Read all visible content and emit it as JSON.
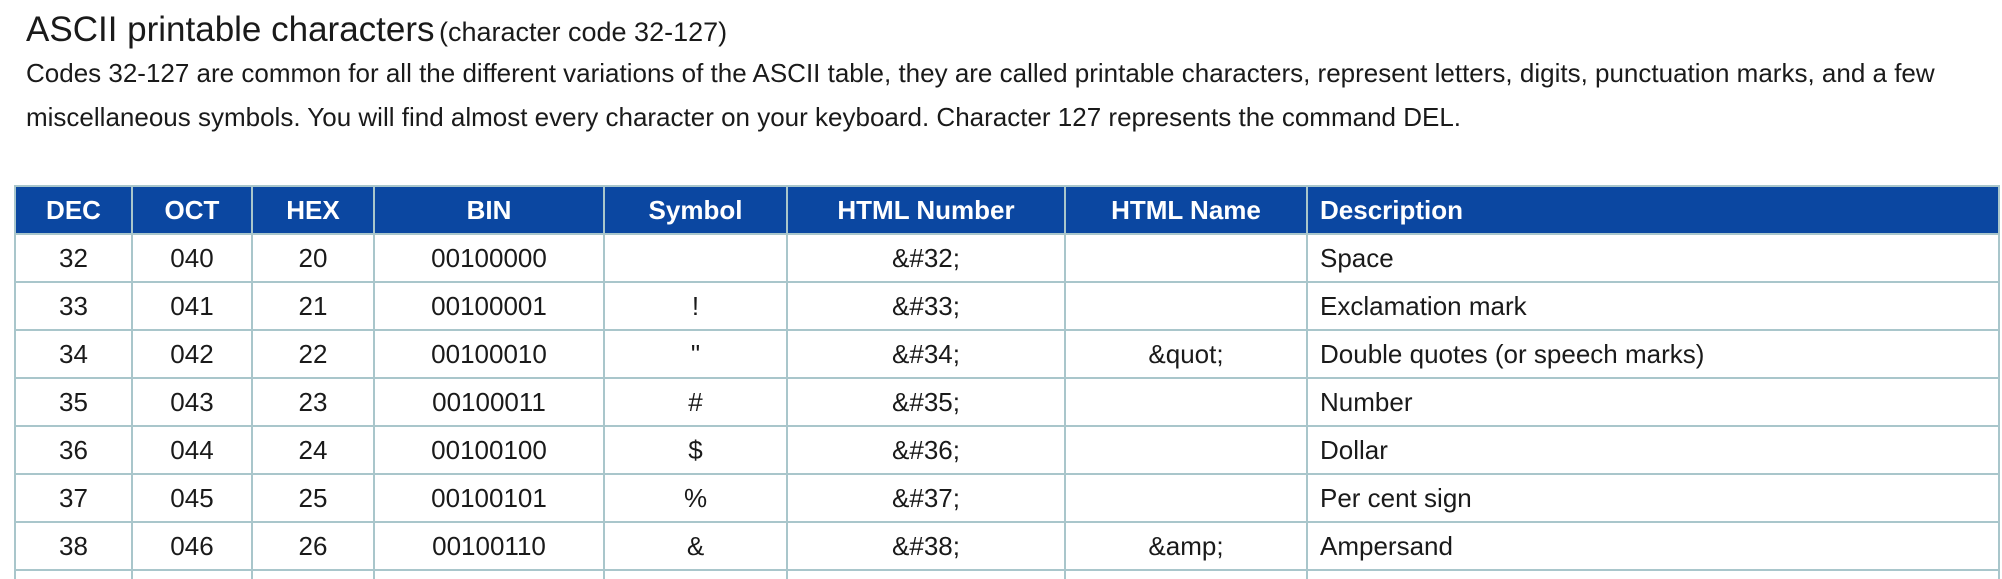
{
  "heading": {
    "title": "ASCII printable characters",
    "subtitle": "(character code 32-127)"
  },
  "intro": "Codes 32-127 are common for all the different variations of the ASCII table, they are called printable characters, represent letters, digits, punctuation marks, and a few miscellaneous symbols. You will find almost every character on your keyboard. Character 127 represents the command DEL.",
  "table": {
    "columns": [
      "DEC",
      "OCT",
      "HEX",
      "BIN",
      "Symbol",
      "HTML Number",
      "HTML Name",
      "Description"
    ],
    "rows": [
      [
        "32",
        "040",
        "20",
        "00100000",
        "",
        "&#32;",
        "",
        "Space"
      ],
      [
        "33",
        "041",
        "21",
        "00100001",
        "!",
        "&#33;",
        "",
        "Exclamation mark"
      ],
      [
        "34",
        "042",
        "22",
        "00100010",
        "\"",
        "&#34;",
        "&quot;",
        "Double quotes (or speech marks)"
      ],
      [
        "35",
        "043",
        "23",
        "00100011",
        "#",
        "&#35;",
        "",
        "Number"
      ],
      [
        "36",
        "044",
        "24",
        "00100100",
        "$",
        "&#36;",
        "",
        "Dollar"
      ],
      [
        "37",
        "045",
        "25",
        "00100101",
        "%",
        "&#37;",
        "",
        "Per cent sign"
      ],
      [
        "38",
        "046",
        "26",
        "00100110",
        "&",
        "&#38;",
        "&amp;",
        "Ampersand"
      ]
    ]
  },
  "colors": {
    "header_bg": "#0b47a1",
    "header_text": "#ffffff",
    "border": "#a9c6cb"
  }
}
